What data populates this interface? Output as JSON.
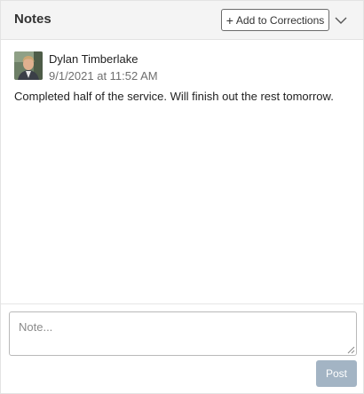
{
  "header": {
    "title": "Notes",
    "add_button_label": "Add to Corrections",
    "add_button_icon": "plus-icon",
    "menu_icon": "chevron-down-icon"
  },
  "notes": [
    {
      "author": "Dylan Timberlake",
      "timestamp": "9/1/2021 at 11:52 AM",
      "text": "Completed half of the service. Will finish out the rest tomorrow.",
      "avatar": "user-photo-avatar"
    }
  ],
  "composer": {
    "placeholder": "Note...",
    "value": "",
    "post_label": "Post"
  },
  "colors": {
    "header_bg": "#f4f4f4",
    "post_button_disabled": "#a3b4c4",
    "timestamp_text": "#6f6f6f"
  }
}
